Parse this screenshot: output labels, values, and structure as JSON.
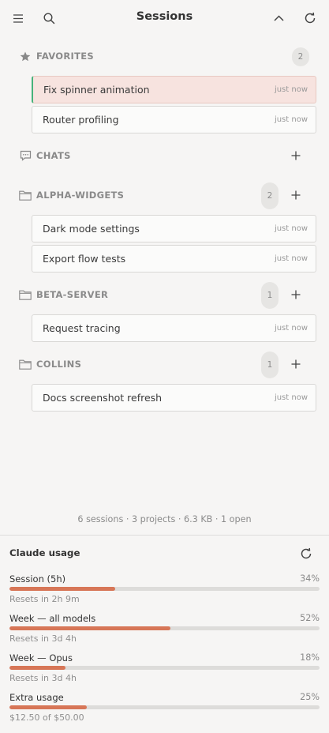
{
  "header": {
    "title": "Sessions",
    "menu_icon": "hamburger-menu-icon",
    "search_icon": "search-icon",
    "collapse_icon": "chevron-up-icon",
    "refresh_icon": "refresh-icon"
  },
  "groups": [
    {
      "id": "favorites",
      "title": "FAVORITES",
      "icon": "star-icon",
      "count": "2",
      "has_add": false,
      "sessions": [
        {
          "name": "Fix spinner animation",
          "time": "just now",
          "active": true
        },
        {
          "name": "Router profiling",
          "time": "just now",
          "active": false
        }
      ]
    },
    {
      "id": "chats",
      "title": "CHATS",
      "icon": "chat-bubble-icon",
      "count": "",
      "has_add": true,
      "sessions": []
    },
    {
      "id": "alpha-widgets",
      "title": "ALPHA-WIDGETS",
      "icon": "folder-icon",
      "count": "2",
      "has_add": true,
      "sessions": [
        {
          "name": "Dark mode settings",
          "time": "just now",
          "active": false
        },
        {
          "name": "Export flow tests",
          "time": "just now",
          "active": false
        }
      ]
    },
    {
      "id": "beta-server",
      "title": "BETA-SERVER",
      "icon": "folder-icon",
      "count": "1",
      "has_add": true,
      "sessions": [
        {
          "name": "Request tracing",
          "time": "just now",
          "active": false
        }
      ]
    },
    {
      "id": "collins",
      "title": "COLLINS",
      "icon": "folder-icon",
      "count": "1",
      "has_add": true,
      "sessions": [
        {
          "name": "Docs screenshot refresh",
          "time": "just now",
          "active": false
        }
      ]
    }
  ],
  "footer": {
    "stats": "6 sessions · 3 projects · 6.3 KB · 1 open"
  },
  "usage": {
    "title": "Claude usage",
    "refresh_icon": "refresh-icon",
    "bar_color": "#d77657",
    "metrics": [
      {
        "label": "Session (5h)",
        "percent": "34%",
        "value": 0.34,
        "sub": "Resets in 2h 9m"
      },
      {
        "label": "Week — all models",
        "percent": "52%",
        "value": 0.52,
        "sub": "Resets in 3d 4h"
      },
      {
        "label": "Week — Opus",
        "percent": "18%",
        "value": 0.18,
        "sub": "Resets in 3d 4h"
      },
      {
        "label": "Extra usage",
        "percent": "25%",
        "value": 0.25,
        "sub": "$12.50 of $50.00"
      }
    ]
  }
}
